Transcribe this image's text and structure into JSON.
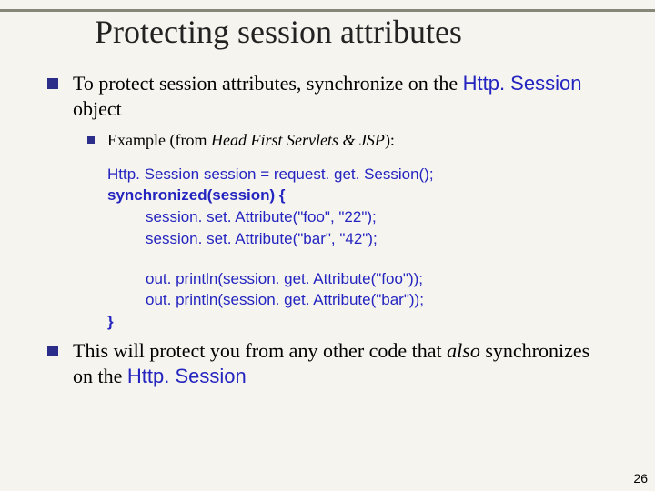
{
  "title": "Protecting session attributes",
  "bullet1_pre": "To protect session attributes, synchronize on the ",
  "bullet1_code": "Http. Session",
  "bullet1_post": " object",
  "bullet1a_pre": "Example (from ",
  "bullet1a_italic": "Head First Servlets & JSP",
  "bullet1a_post": "):",
  "code": {
    "l1": "Http. Session session = request. get. Session();",
    "l2": "synchronized(session) {",
    "l3": "session. set. Attribute(\"foo\", \"22\");",
    "l4": "session. set. Attribute(\"bar\", \"42\");",
    "l5": "out. println(session. get. Attribute(\"foo\"));",
    "l6": "out. println(session. get. Attribute(\"bar\"));",
    "l7": "}"
  },
  "bullet2_pre": "This will protect you from any other code that ",
  "bullet2_italic": "also",
  "bullet2_mid": " synchronizes on the ",
  "bullet2_code": "Http. Session",
  "page_number": "26"
}
